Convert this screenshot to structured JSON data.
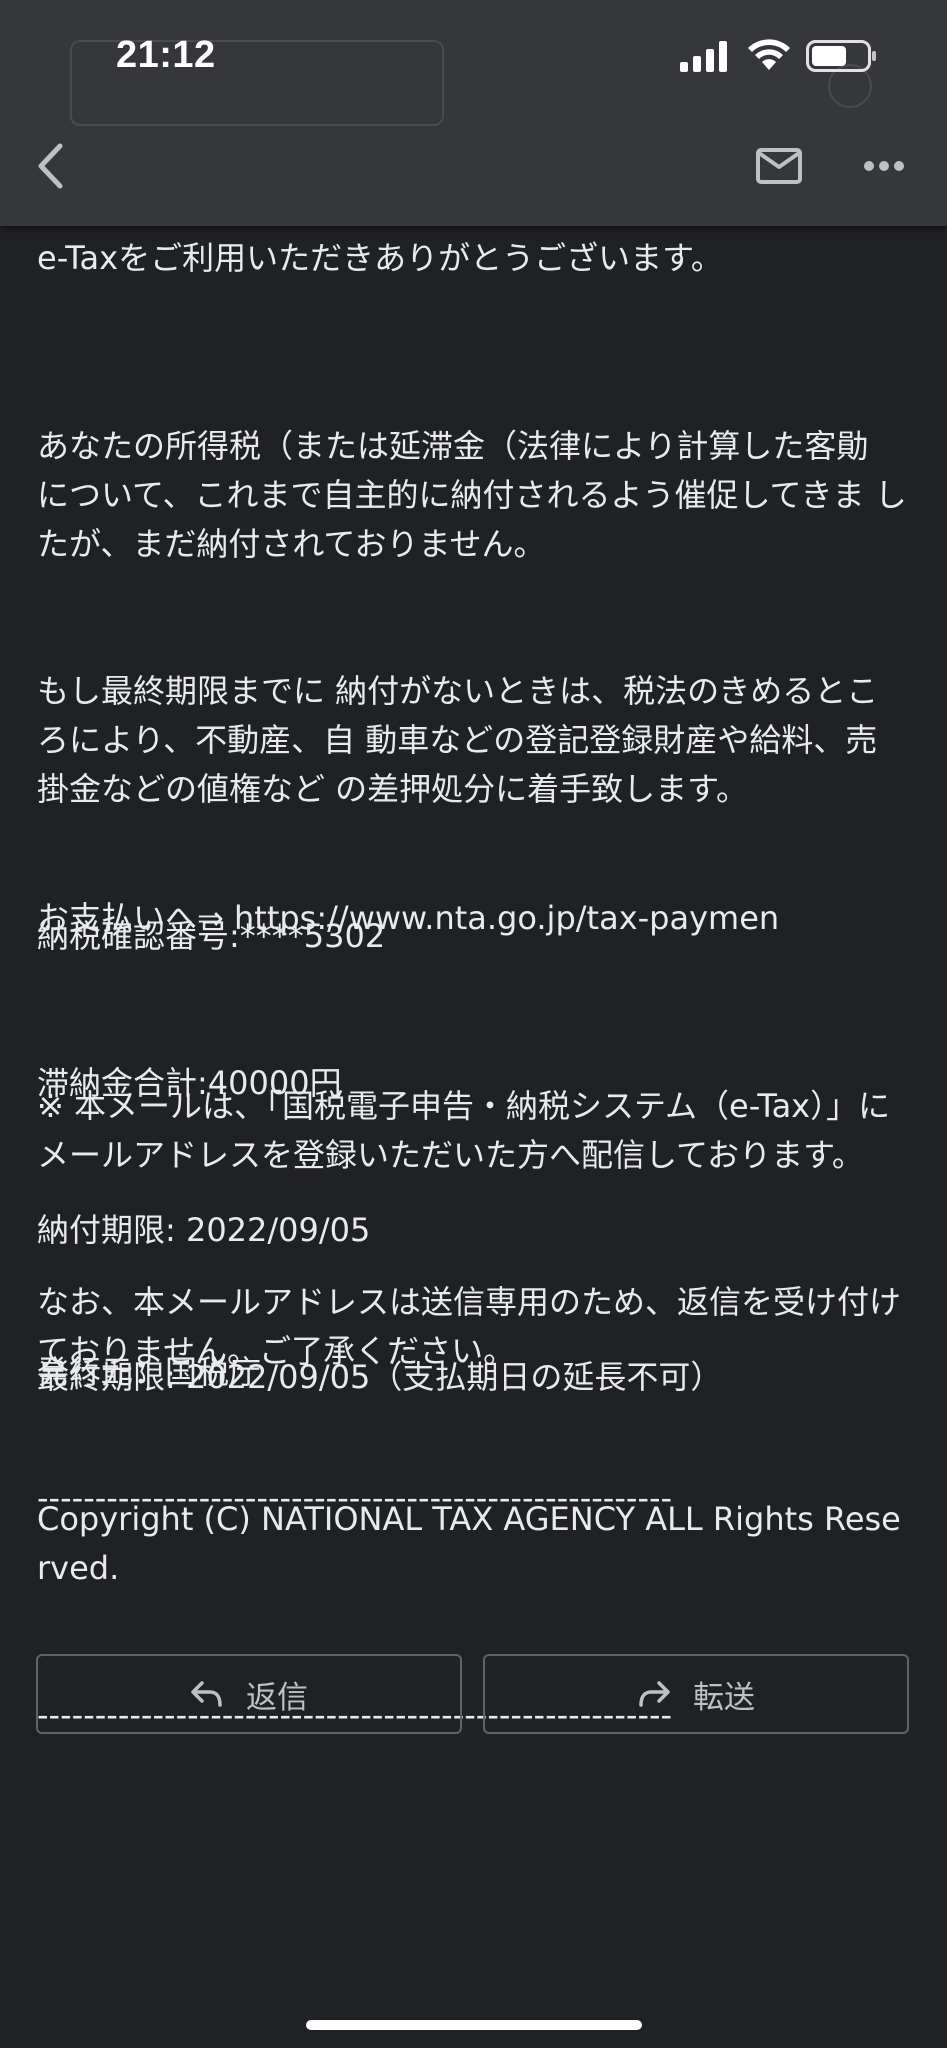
{
  "status_bar": {
    "time": "21:12"
  },
  "toolbar": {
    "icons": [
      "back-chevron-icon",
      "mail-icon",
      "more-horizontal-icon"
    ]
  },
  "email": {
    "thanks": "e-Taxをご利用いただきありがとうございます。",
    "body_lines": [
      "あなたの所得税（または延滞金（法律により計算した客勛 について、これまで自主的に納付されるよう催促してきま したが、まだ納付されておりません。",
      "もし最終期限までに 納付がないときは、税法のきめるところにより、不動産、自 動車などの登記登録財産や給料、売掛金などの値権など の差押処分に着手致します。",
      "納税確認番号:****5302",
      "滞納金合計:40000円",
      "納付期限: 2022/09/05",
      "最終期限: 2022/09/05（支払期日の延長不可）"
    ],
    "payment_link": "お支払いへ⇒ https://www.nta.go.jp/tax-paymen",
    "notice_lines": [
      "※ 本メールは、「国税電子申告・納税システム（e-Tax）」にメールアドレスを登録いただいた方へ配信しております。",
      "なお、本メールアドレスは送信専用のため、返信を受け付けておりません。ご了承ください。",
      "-------------------------------------------------------"
    ],
    "footer_lines": [
      "発行元：国税庁",
      "Copyright (C) NATIONAL TAX AGENCY ALL Rights Reserved.",
      "-------------------------------------------------------"
    ]
  },
  "actions": {
    "reply_label": "返信",
    "forward_label": "転送"
  },
  "colors": {
    "background": "#202124",
    "toolbar": "#36373a",
    "text": "#e8eaed",
    "button_border": "#5f6368"
  }
}
